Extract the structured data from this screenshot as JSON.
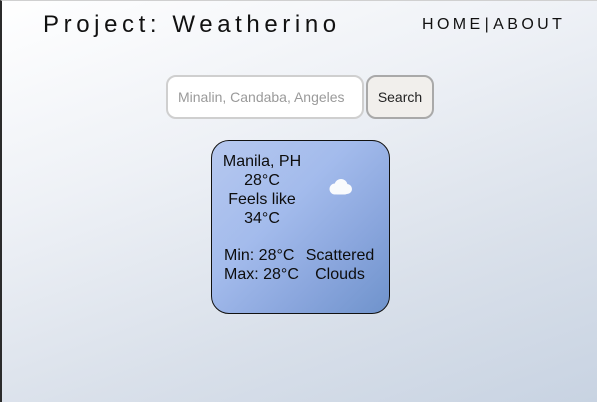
{
  "app": {
    "title": "Project: Weatherino"
  },
  "nav": {
    "home_label": "HOME",
    "separator": "|",
    "about_label": "ABOUT"
  },
  "search": {
    "placeholder": "Minalin, Candaba, Angeles",
    "value": "",
    "button_label": "Search"
  },
  "weather": {
    "location": "Manila, PH",
    "temperature": "28°C",
    "feels_like_label": "Feels like",
    "feels_like_value": "34°C",
    "min": "Min: 28°C",
    "max": "Max: 28°C",
    "condition": "Scattered Clouds",
    "icon": "cloud-icon"
  },
  "colors": {
    "card_gradient_start": "#b6c8ef",
    "card_gradient_end": "#6f93cc",
    "cloud": "#ffffff"
  }
}
